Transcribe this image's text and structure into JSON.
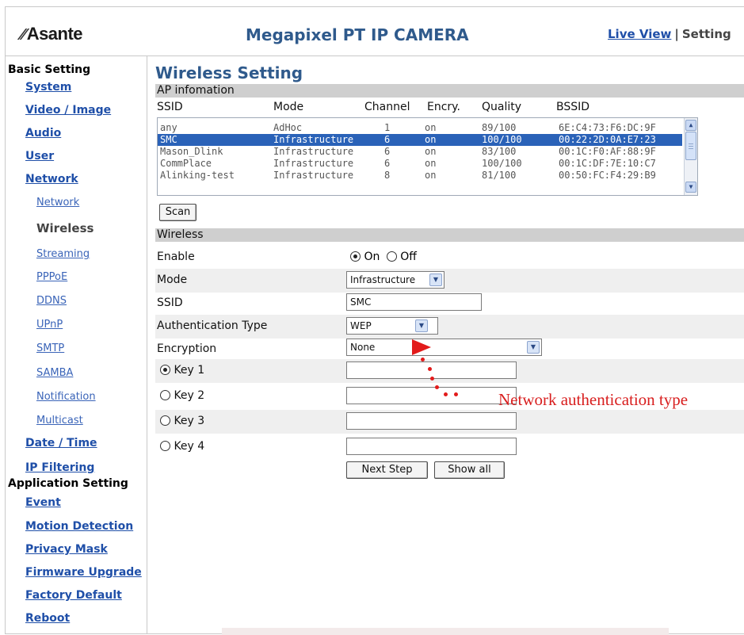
{
  "header": {
    "brand": "Asante",
    "brand_mark": "⁄⁄",
    "product": "Megapixel PT IP CAMERA",
    "nav_live_view": "Live View",
    "nav_sep": "|",
    "nav_setting": "Setting"
  },
  "sidebar": {
    "basic_group": "Basic Setting",
    "system": "System",
    "video_image": "Video / Image",
    "audio": "Audio",
    "user": "User",
    "network": "Network",
    "sub_network": "Network",
    "sub_wireless": "Wireless",
    "sub_streaming": "Streaming",
    "sub_pppoe": "PPPoE",
    "sub_ddns": "DDNS",
    "sub_upnp": "UPnP",
    "sub_smtp": "SMTP",
    "sub_samba": "SAMBA",
    "sub_notification": "Notification",
    "sub_multicast": "Multicast",
    "date_time": "Date / Time",
    "ip_filtering": "IP Filtering",
    "app_group": "Application Setting",
    "event": "Event",
    "motion_detection": "Motion Detection",
    "privacy_mask": "Privacy Mask",
    "firmware_upgrade": "Firmware Upgrade",
    "factory_default": "Factory Default",
    "reboot": "Reboot"
  },
  "main": {
    "title": "Wireless Setting",
    "ap_section": "AP infomation",
    "columns": {
      "ssid": "SSID",
      "mode": "Mode",
      "channel": "Channel",
      "encry": "Encry.",
      "quality": "Quality",
      "bssid": "BSSID"
    },
    "ap_rows": [
      {
        "ssid": "any",
        "mode": "AdHoc",
        "channel": "1",
        "encry": "on",
        "quality": "89/100",
        "bssid": "6E:C4:73:F6:DC:9F"
      },
      {
        "ssid": "SMC",
        "mode": "Infrastructure",
        "channel": "6",
        "encry": "on",
        "quality": "100/100",
        "bssid": "00:22:2D:0A:E7:23"
      },
      {
        "ssid": "Mason_Dlink",
        "mode": "Infrastructure",
        "channel": "6",
        "encry": "on",
        "quality": "83/100",
        "bssid": "00:1C:F0:AF:88:9F"
      },
      {
        "ssid": "CommPlace",
        "mode": "Infrastructure",
        "channel": "6",
        "encry": "on",
        "quality": "100/100",
        "bssid": "00:1C:DF:7E:10:C7"
      },
      {
        "ssid": "Alinking-test",
        "mode": "Infrastructure",
        "channel": "8",
        "encry": "on",
        "quality": "81/100",
        "bssid": "00:50:FC:F4:29:B9"
      }
    ],
    "selected_row": 1,
    "scan_button": "Scan",
    "wireless_section": "Wireless",
    "enable_label": "Enable",
    "enable_on": "On",
    "enable_off": "Off",
    "enable_value": "On",
    "mode_label": "Mode",
    "mode_value": "Infrastructure",
    "ssid_label": "SSID",
    "ssid_value": "SMC",
    "auth_label": "Authentication Type",
    "auth_value": "WEP",
    "encryption_label": "Encryption",
    "encryption_value": "None",
    "key1_label": "Key 1",
    "key2_label": "Key 2",
    "key3_label": "Key 3",
    "key4_label": "Key 4",
    "key_selected": "Key 1",
    "next_button": "Next Step",
    "show_all_button": "Show all"
  },
  "annotation": {
    "text": "Network authentication type",
    "color": "#d81e1e"
  }
}
